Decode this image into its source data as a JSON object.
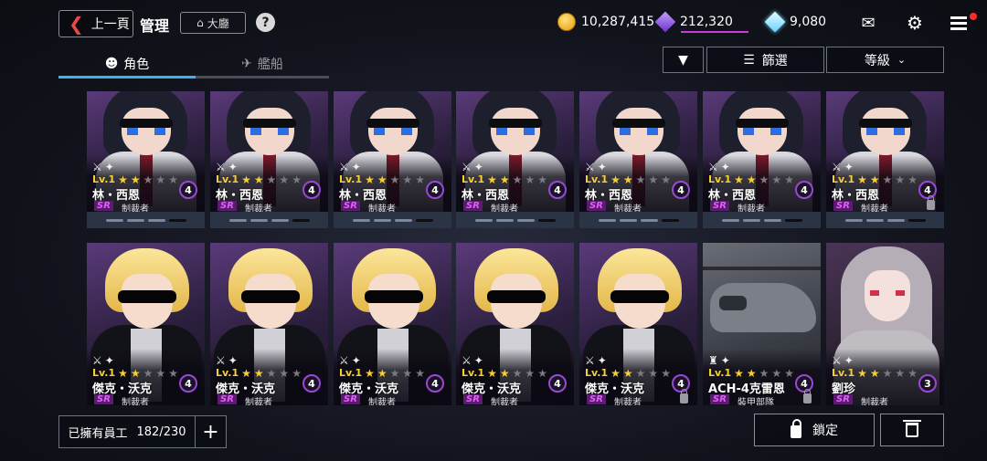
{
  "header": {
    "back_label": "上一頁",
    "title": "管理",
    "lobby_label": "大廳",
    "help_label": "?"
  },
  "currency": {
    "gold": "10,287,415",
    "gems": "212,320",
    "crystals": "9,080"
  },
  "tabs": [
    {
      "label": "角色",
      "active": true
    },
    {
      "label": "艦船",
      "active": false
    }
  ],
  "toolbar": {
    "filter_label": "篩選",
    "sort_label": "等級"
  },
  "cards": [
    {
      "name": "林・西恩",
      "level": "Lv.1",
      "stars": 2,
      "count": "4",
      "rarity": "SR",
      "role": "制裁者",
      "locked": false
    },
    {
      "name": "林・西恩",
      "level": "Lv.1",
      "stars": 2,
      "count": "4",
      "rarity": "SR",
      "role": "制裁者",
      "locked": false
    },
    {
      "name": "林・西恩",
      "level": "Lv.1",
      "stars": 2,
      "count": "4",
      "rarity": "SR",
      "role": "制裁者",
      "locked": false
    },
    {
      "name": "林・西恩",
      "level": "Lv.1",
      "stars": 2,
      "count": "4",
      "rarity": "SR",
      "role": "制裁者",
      "locked": false
    },
    {
      "name": "林・西恩",
      "level": "Lv.1",
      "stars": 2,
      "count": "4",
      "rarity": "SR",
      "role": "制裁者",
      "locked": false
    },
    {
      "name": "林・西恩",
      "level": "Lv.1",
      "stars": 2,
      "count": "4",
      "rarity": "SR",
      "role": "制裁者",
      "locked": false
    },
    {
      "name": "林・西恩",
      "level": "Lv.1",
      "stars": 2,
      "count": "4",
      "rarity": "SR",
      "role": "制裁者",
      "locked": true
    },
    {
      "name": "傑克・沃克",
      "level": "Lv.1",
      "stars": 2,
      "count": "4",
      "rarity": "SR",
      "role": "制裁者",
      "locked": false
    },
    {
      "name": "傑克・沃克",
      "level": "Lv.1",
      "stars": 2,
      "count": "4",
      "rarity": "SR",
      "role": "制裁者",
      "locked": false
    },
    {
      "name": "傑克・沃克",
      "level": "Lv.1",
      "stars": 2,
      "count": "4",
      "rarity": "SR",
      "role": "制裁者",
      "locked": false
    },
    {
      "name": "傑克・沃克",
      "level": "Lv.1",
      "stars": 2,
      "count": "4",
      "rarity": "SR",
      "role": "制裁者",
      "locked": false
    },
    {
      "name": "傑克・沃克",
      "level": "Lv.1",
      "stars": 2,
      "count": "4",
      "rarity": "SR",
      "role": "制裁者",
      "locked": true
    },
    {
      "name": "ACH-4克雷恩",
      "level": "Lv.1",
      "stars": 2,
      "count": "4",
      "rarity": "SR",
      "role": "裝甲部隊",
      "locked": true
    },
    {
      "name": "劉珍",
      "level": "Lv.1",
      "stars": 2,
      "count": "3",
      "rarity": "SR",
      "role": "制裁者",
      "locked": false
    }
  ],
  "footer": {
    "employee_label": "已擁有員工",
    "employee_count": "182/230",
    "add_label": "+",
    "lock_label": "鎖定"
  },
  "colors": {
    "accent_tab": "#3fb2ee",
    "star_gold": "#f3cf3a",
    "rarity_purple": "#e55bff",
    "badge_ring": "#9b47d6",
    "notification": "#ff2a2a"
  }
}
